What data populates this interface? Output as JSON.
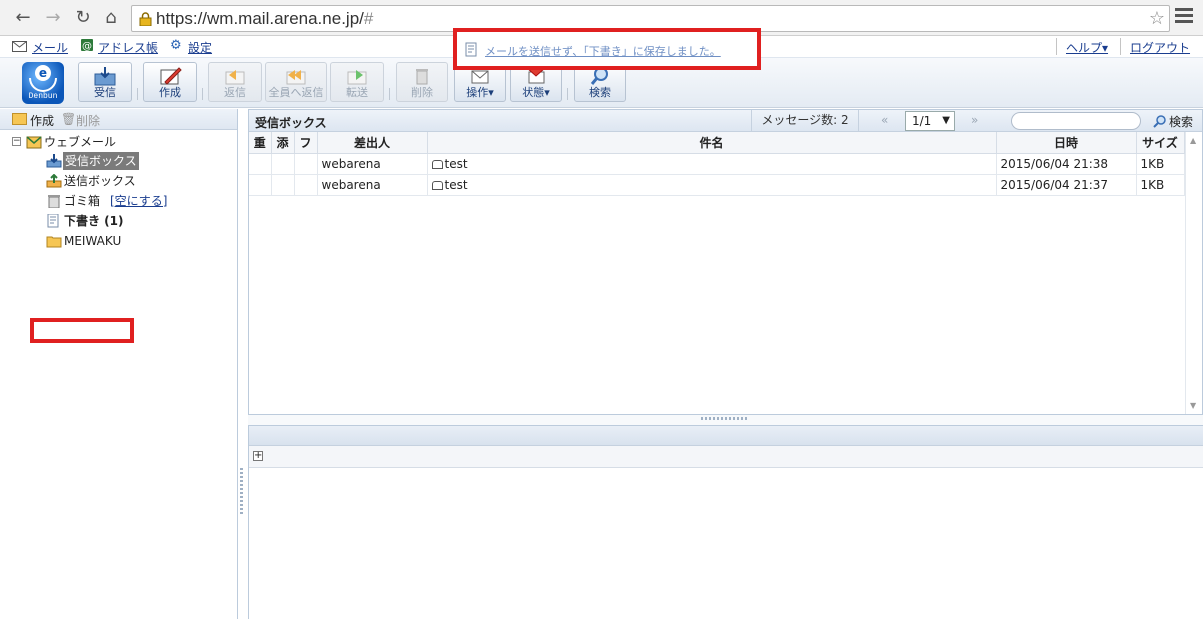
{
  "browser": {
    "url": "https://wm.mail.arena.ne.jp/",
    "url_hash": "#"
  },
  "toplinks": {
    "mail": "メール",
    "addressbook": "アドレス帳",
    "settings": "設定",
    "help": "ヘルプ▾",
    "logout": "ログアウト"
  },
  "notification": {
    "text": "メールを送信せず、「下書き」に保存しました。"
  },
  "toolbar": {
    "logo_text": "Denbun",
    "receive": "受信",
    "compose": "作成",
    "reply": "返信",
    "reply_all": "全員へ返信",
    "forward": "転送",
    "delete": "削除",
    "operation": "操作▾",
    "status": "状態▾",
    "search": "検索"
  },
  "left": {
    "create": "作成",
    "delete": "削除",
    "root": "ウェブメール",
    "folders": {
      "inbox": "受信ボックス",
      "sent": "送信ボックス",
      "trash": "ゴミ箱",
      "trash_empty": "[空にする]",
      "drafts": "下書き (1)",
      "meiwaku": "MEIWAKU"
    }
  },
  "list": {
    "title": "受信ボックス",
    "count": "メッセージ数: 2",
    "prev": "«",
    "next": "»",
    "page": "1/1",
    "search_label": "検索",
    "columns": {
      "priority": "重",
      "attach": "添",
      "flag": "フ",
      "from": "差出人",
      "subject": "件名",
      "date": "日時",
      "size": "サイズ"
    },
    "rows": [
      {
        "from": "webarena",
        "subject": "test",
        "date": "2015/06/04 21:38",
        "size": "1KB"
      },
      {
        "from": "webarena",
        "subject": "test",
        "date": "2015/06/04 21:37",
        "size": "1KB"
      }
    ]
  },
  "preview": {
    "expand": "+"
  }
}
